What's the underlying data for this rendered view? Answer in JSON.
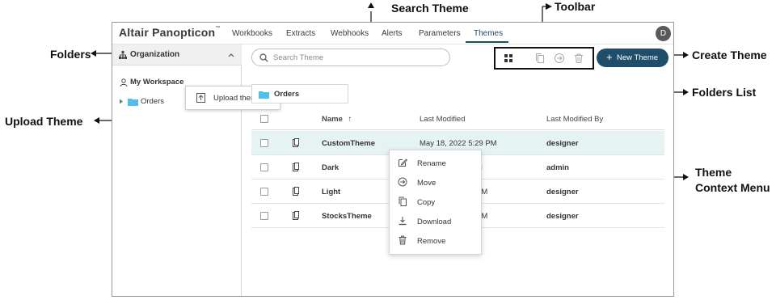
{
  "annotations": {
    "search_theme": "Search Theme",
    "toolbar": "Toolbar",
    "folders": "Folders",
    "create_theme": "Create Theme",
    "folders_list": "Folders List",
    "upload_theme": "Upload Theme",
    "theme_context_menu_line1": "Theme",
    "theme_context_menu_line2": "Context Menu"
  },
  "app": {
    "brand": "Altair Panopticon",
    "brand_mark": "™",
    "avatar_initial": "D",
    "nav_tabs": [
      "Workbooks",
      "Extracts",
      "Webhooks",
      "Alerts",
      "Parameters",
      "Themes"
    ],
    "active_tab": "Themes"
  },
  "sidebar": {
    "org_label": "Organization",
    "my_workspace": "My Workspace",
    "tree_items": [
      "Orders"
    ],
    "upload_popup_label": "Upload theme"
  },
  "search": {
    "placeholder": "Search Theme",
    "value": ""
  },
  "actions": {
    "new_theme_label": "New Theme",
    "toolbar_icons": [
      "grid-view-icon",
      "copy-icon",
      "move-icon",
      "trash-icon"
    ]
  },
  "folders_list": {
    "current": "Orders"
  },
  "table": {
    "headers": {
      "name": "Name",
      "sort_indicator": "↑",
      "last_modified": "Last Modified",
      "last_modified_by": "Last Modified By"
    },
    "rows": [
      {
        "name": "CustomTheme",
        "modified": "May 18, 2022 5:29 PM",
        "by": "designer"
      },
      {
        "name": "Dark",
        "modified": "M",
        "by": "admin"
      },
      {
        "name": "Light",
        "modified": "PM",
        "by": "designer"
      },
      {
        "name": "StocksTheme",
        "modified": "PM",
        "by": "designer"
      }
    ]
  },
  "context_menu": {
    "items": [
      "Rename",
      "Move",
      "Copy",
      "Download",
      "Remove"
    ]
  },
  "colors": {
    "brand_blue": "#1f4e6b",
    "folder_blue": "#4fc1e9",
    "selected_row": "#e6f3f3"
  }
}
